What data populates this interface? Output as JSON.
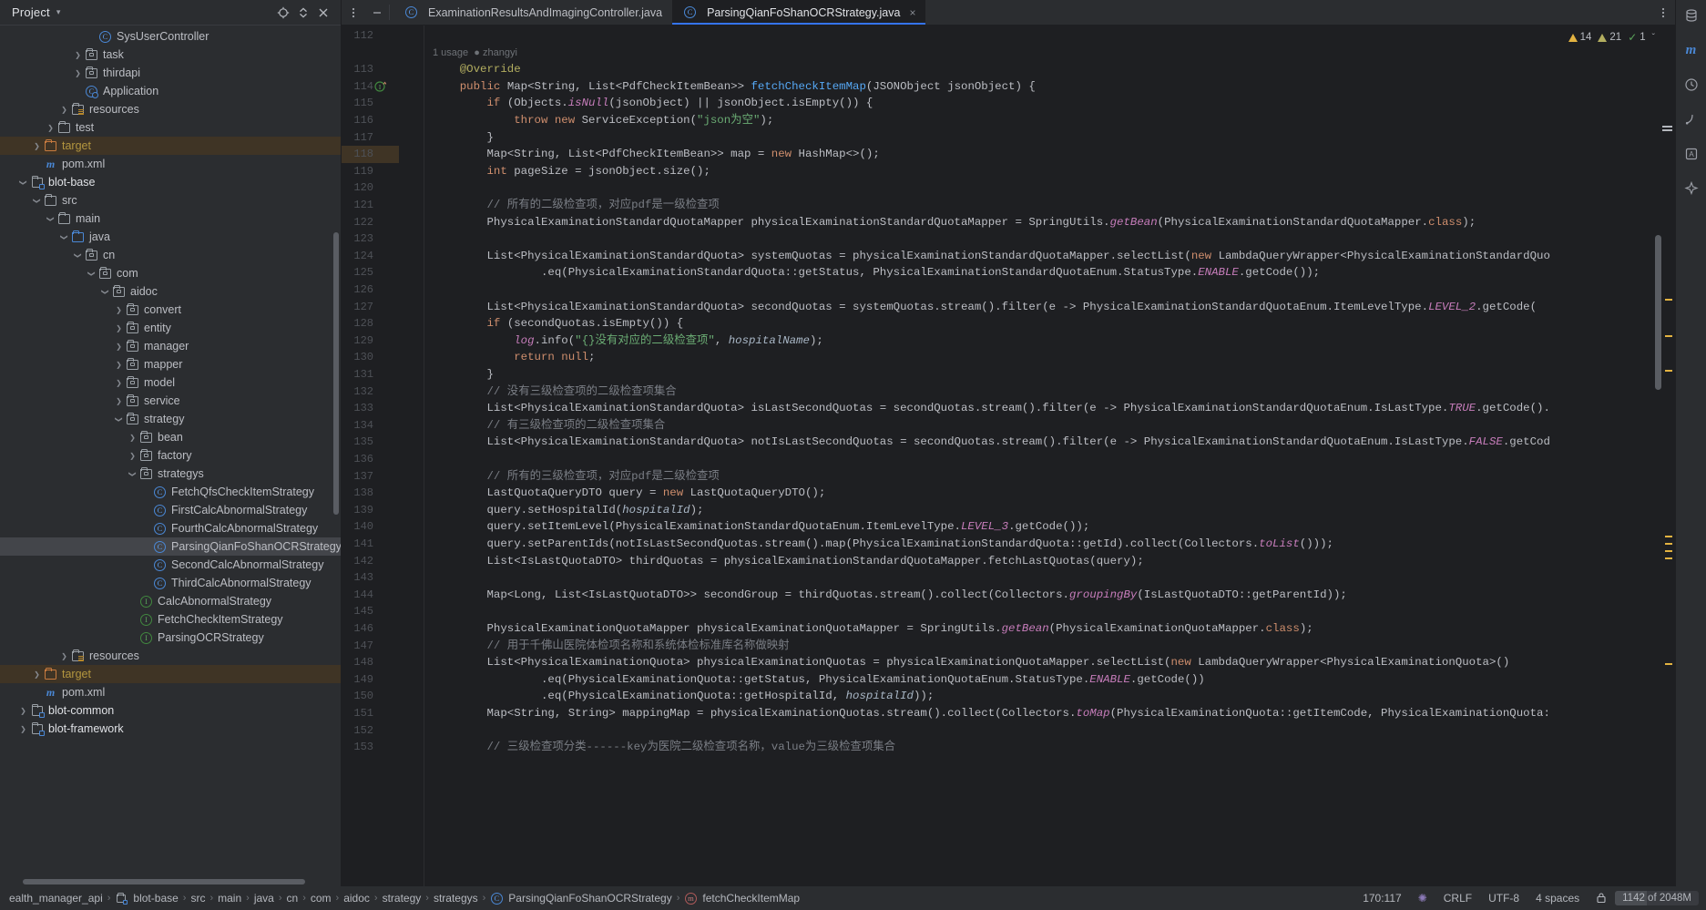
{
  "window": {
    "project_panel_title": "Project",
    "header_icons": [
      "target-icon",
      "collapse-icon",
      "close-icon",
      "more-icon",
      "minimize-icon"
    ]
  },
  "tabs": {
    "items": [
      {
        "label": "ExaminationResultsAndImagingController.java",
        "icon": "java-class-icon",
        "active": false,
        "closable": false
      },
      {
        "label": "ParsingQianFoShanOCRStrategy.java",
        "icon": "java-class-icon",
        "active": true,
        "closable": true,
        "close_glyph": "×"
      }
    ]
  },
  "inspections": {
    "warnings_count": "14",
    "weak_warnings_count": "21",
    "checks_count": "1",
    "chevron": "ˇ"
  },
  "tree": {
    "items": [
      {
        "indent": 6,
        "arrow": "none",
        "icon": "java-class-icon",
        "label": "SysUserController",
        "state": ""
      },
      {
        "indent": 5,
        "arrow": "right",
        "icon": "package-icon",
        "label": "task",
        "state": ""
      },
      {
        "indent": 5,
        "arrow": "right",
        "icon": "package-icon",
        "label": "thirdapi",
        "state": ""
      },
      {
        "indent": 5,
        "arrow": "none",
        "icon": "spring-application-icon",
        "label": "Application",
        "state": ""
      },
      {
        "indent": 4,
        "arrow": "right",
        "icon": "resources-folder-icon",
        "label": "resources",
        "state": ""
      },
      {
        "indent": 3,
        "arrow": "right",
        "icon": "folder-icon",
        "label": "test",
        "state": ""
      },
      {
        "indent": 2,
        "arrow": "right",
        "icon": "folder-orange-icon",
        "label": "target",
        "state": "target"
      },
      {
        "indent": 2,
        "arrow": "none",
        "icon": "maven-icon",
        "label": "pom.xml",
        "state": ""
      },
      {
        "indent": 1,
        "arrow": "down",
        "icon": "module-icon",
        "label": "blot-base",
        "state": "bold"
      },
      {
        "indent": 2,
        "arrow": "down",
        "icon": "folder-icon",
        "label": "src",
        "state": ""
      },
      {
        "indent": 3,
        "arrow": "down",
        "icon": "folder-icon",
        "label": "main",
        "state": ""
      },
      {
        "indent": 4,
        "arrow": "down",
        "icon": "source-folder-icon",
        "label": "java",
        "state": ""
      },
      {
        "indent": 5,
        "arrow": "down",
        "icon": "package-icon",
        "label": "cn",
        "state": ""
      },
      {
        "indent": 6,
        "arrow": "down",
        "icon": "package-icon",
        "label": "com",
        "state": ""
      },
      {
        "indent": 7,
        "arrow": "down",
        "icon": "package-icon",
        "label": "aidoc",
        "state": ""
      },
      {
        "indent": 8,
        "arrow": "right",
        "icon": "package-icon",
        "label": "convert",
        "state": ""
      },
      {
        "indent": 8,
        "arrow": "right",
        "icon": "package-icon",
        "label": "entity",
        "state": ""
      },
      {
        "indent": 8,
        "arrow": "right",
        "icon": "package-icon",
        "label": "manager",
        "state": ""
      },
      {
        "indent": 8,
        "arrow": "right",
        "icon": "package-icon",
        "label": "mapper",
        "state": ""
      },
      {
        "indent": 8,
        "arrow": "right",
        "icon": "package-icon",
        "label": "model",
        "state": ""
      },
      {
        "indent": 8,
        "arrow": "right",
        "icon": "package-icon",
        "label": "service",
        "state": ""
      },
      {
        "indent": 8,
        "arrow": "down",
        "icon": "package-icon",
        "label": "strategy",
        "state": ""
      },
      {
        "indent": 9,
        "arrow": "right",
        "icon": "package-icon",
        "label": "bean",
        "state": ""
      },
      {
        "indent": 9,
        "arrow": "right",
        "icon": "package-icon",
        "label": "factory",
        "state": ""
      },
      {
        "indent": 9,
        "arrow": "down",
        "icon": "package-icon",
        "label": "strategys",
        "state": ""
      },
      {
        "indent": 10,
        "arrow": "none",
        "icon": "java-class-icon",
        "label": "FetchQfsCheckItemStrategy",
        "state": ""
      },
      {
        "indent": 10,
        "arrow": "none",
        "icon": "java-class-icon",
        "label": "FirstCalcAbnormalStrategy",
        "state": ""
      },
      {
        "indent": 10,
        "arrow": "none",
        "icon": "java-class-icon",
        "label": "FourthCalcAbnormalStrategy",
        "state": ""
      },
      {
        "indent": 10,
        "arrow": "none",
        "icon": "java-class-icon",
        "label": "ParsingQianFoShanOCRStrategy",
        "state": "selected"
      },
      {
        "indent": 10,
        "arrow": "none",
        "icon": "java-class-icon",
        "label": "SecondCalcAbnormalStrategy",
        "state": ""
      },
      {
        "indent": 10,
        "arrow": "none",
        "icon": "java-class-icon",
        "label": "ThirdCalcAbnormalStrategy",
        "state": ""
      },
      {
        "indent": 9,
        "arrow": "none",
        "icon": "java-interface-icon",
        "label": "CalcAbnormalStrategy",
        "state": ""
      },
      {
        "indent": 9,
        "arrow": "none",
        "icon": "java-interface-icon",
        "label": "FetchCheckItemStrategy",
        "state": ""
      },
      {
        "indent": 9,
        "arrow": "none",
        "icon": "java-interface-icon",
        "label": "ParsingOCRStrategy",
        "state": ""
      },
      {
        "indent": 4,
        "arrow": "right",
        "icon": "resources-folder-icon",
        "label": "resources",
        "state": ""
      },
      {
        "indent": 2,
        "arrow": "right",
        "icon": "folder-orange-icon",
        "label": "target",
        "state": "target"
      },
      {
        "indent": 2,
        "arrow": "none",
        "icon": "maven-icon",
        "label": "pom.xml",
        "state": ""
      },
      {
        "indent": 1,
        "arrow": "right",
        "icon": "module-icon",
        "label": "blot-common",
        "state": "bold"
      },
      {
        "indent": 1,
        "arrow": "right",
        "icon": "module-icon",
        "label": "blot-framework",
        "state": "bold"
      }
    ]
  },
  "editor": {
    "inlay_hint": {
      "usages": "1 usage",
      "author": "zhangyi"
    },
    "first_line_number": 112,
    "lines": [
      {
        "n": 112,
        "tokens": []
      },
      {
        "n": 113,
        "tokens": [
          {
            "t": "@Override",
            "c": "anno",
            "i": 4
          }
        ]
      },
      {
        "n": 114,
        "gutter_icon": "override-method-icon",
        "tokens": [
          {
            "t": "public ",
            "c": "kw",
            "i": 4
          },
          {
            "t": "Map<String, List<PdfCheckItemBean>> ",
            "c": "ty"
          },
          {
            "t": "fetchCheckItemMap",
            "c": "meth"
          },
          {
            "t": "(JSONObject jsonObject) {",
            "c": "ty"
          }
        ]
      },
      {
        "n": 115,
        "tokens": [
          {
            "t": "if ",
            "c": "kw",
            "i": 8
          },
          {
            "t": "(Objects.",
            "c": "ty"
          },
          {
            "t": "isNull",
            "c": "st"
          },
          {
            "t": "(jsonObject) || jsonObject.isEmpty()) {",
            "c": "ty"
          }
        ]
      },
      {
        "n": 116,
        "tokens": [
          {
            "t": "throw new ",
            "c": "kw",
            "i": 12
          },
          {
            "t": "ServiceException(",
            "c": "ty"
          },
          {
            "t": "\"json为空\"",
            "c": "str"
          },
          {
            "t": ");",
            "c": "ty"
          }
        ]
      },
      {
        "n": 117,
        "tokens": [
          {
            "t": "}",
            "c": "ty",
            "i": 8
          }
        ]
      },
      {
        "n": 118,
        "tokens": [
          {
            "t": "Map<String, List<PdfCheckItemBean>> map = ",
            "c": "ty",
            "i": 8
          },
          {
            "t": "new ",
            "c": "kw"
          },
          {
            "t": "HashMap<>();",
            "c": "ty"
          }
        ]
      },
      {
        "n": 119,
        "tokens": [
          {
            "t": "int ",
            "c": "kw",
            "i": 8
          },
          {
            "t": "pageSize = jsonObject.size();",
            "c": "ty"
          }
        ]
      },
      {
        "n": 120,
        "tokens": []
      },
      {
        "n": 121,
        "tokens": [
          {
            "t": "// 所有的二级检查项，对应pdf是一级检查项",
            "c": "cmt",
            "i": 8
          }
        ]
      },
      {
        "n": 122,
        "tokens": [
          {
            "t": "PhysicalExaminationStandardQuotaMapper physicalExaminationStandardQuotaMapper = SpringUtils.",
            "c": "ty",
            "i": 8
          },
          {
            "t": "getBean",
            "c": "st"
          },
          {
            "t": "(PhysicalExaminationStandardQuotaMapper.",
            "c": "ty"
          },
          {
            "t": "class",
            "c": "kw"
          },
          {
            "t": ");",
            "c": "ty"
          }
        ]
      },
      {
        "n": 123,
        "tokens": []
      },
      {
        "n": 124,
        "tokens": [
          {
            "t": "List<PhysicalExaminationStandardQuota> systemQuotas = physicalExaminationStandardQuotaMapper.selectList(",
            "c": "ty",
            "i": 8
          },
          {
            "t": "new ",
            "c": "kw"
          },
          {
            "t": "LambdaQueryWrapper<PhysicalExaminationStandardQuo",
            "c": "ty"
          }
        ]
      },
      {
        "n": 125,
        "tokens": [
          {
            "t": ".eq(PhysicalExaminationStandardQuota::getStatus, PhysicalExaminationStandardQuotaEnum.StatusType.",
            "c": "ty",
            "i": 16
          },
          {
            "t": "ENABLE",
            "c": "st"
          },
          {
            "t": ".getCode());",
            "c": "ty"
          }
        ]
      },
      {
        "n": 126,
        "tokens": []
      },
      {
        "n": 127,
        "tokens": [
          {
            "t": "List<PhysicalExaminationStandardQuota> secondQuotas = systemQuotas.stream().filter(e -> PhysicalExaminationStandardQuotaEnum.ItemLevelType.",
            "c": "ty",
            "i": 8
          },
          {
            "t": "LEVEL_2",
            "c": "st"
          },
          {
            "t": ".getCode(",
            "c": "ty"
          }
        ]
      },
      {
        "n": 128,
        "tokens": [
          {
            "t": "if ",
            "c": "kw",
            "i": 8
          },
          {
            "t": "(secondQuotas.isEmpty()) {",
            "c": "ty"
          }
        ]
      },
      {
        "n": 129,
        "tokens": [
          {
            "t": "log",
            "c": "st",
            "i": 12
          },
          {
            "t": ".info(",
            "c": "ty"
          },
          {
            "t": "\"{}没有对应的二级检查项\"",
            "c": "str"
          },
          {
            "t": ", ",
            "c": "ty"
          },
          {
            "t": "hospitalName",
            "c": "par"
          },
          {
            "t": ");",
            "c": "ty"
          }
        ]
      },
      {
        "n": 130,
        "tokens": [
          {
            "t": "return null",
            "c": "kw",
            "i": 12
          },
          {
            "t": ";",
            "c": "ty"
          }
        ]
      },
      {
        "n": 131,
        "tokens": [
          {
            "t": "}",
            "c": "ty",
            "i": 8
          }
        ]
      },
      {
        "n": 132,
        "tokens": [
          {
            "t": "// 没有三级检查项的二级检查项集合",
            "c": "cmt",
            "i": 8
          }
        ]
      },
      {
        "n": 133,
        "tokens": [
          {
            "t": "List<PhysicalExaminationStandardQuota> isLastSecondQuotas = secondQuotas.stream().filter(e -> PhysicalExaminationStandardQuotaEnum.IsLastType.",
            "c": "ty",
            "i": 8
          },
          {
            "t": "TRUE",
            "c": "st"
          },
          {
            "t": ".getCode().",
            "c": "ty"
          }
        ]
      },
      {
        "n": 134,
        "tokens": [
          {
            "t": "// 有三级检查项的二级检查项集合",
            "c": "cmt",
            "i": 8
          }
        ]
      },
      {
        "n": 135,
        "tokens": [
          {
            "t": "List<PhysicalExaminationStandardQuota> notIsLastSecondQuotas = secondQuotas.stream().filter(e -> PhysicalExaminationStandardQuotaEnum.IsLastType.",
            "c": "ty",
            "i": 8
          },
          {
            "t": "FALSE",
            "c": "st"
          },
          {
            "t": ".getCod",
            "c": "ty"
          }
        ]
      },
      {
        "n": 136,
        "tokens": []
      },
      {
        "n": 137,
        "tokens": [
          {
            "t": "// 所有的三级检查项，对应pdf是二级检查项",
            "c": "cmt",
            "i": 8
          }
        ]
      },
      {
        "n": 138,
        "tokens": [
          {
            "t": "LastQuotaQueryDTO query = ",
            "c": "ty",
            "i": 8
          },
          {
            "t": "new ",
            "c": "kw"
          },
          {
            "t": "LastQuotaQueryDTO();",
            "c": "ty"
          }
        ]
      },
      {
        "n": 139,
        "tokens": [
          {
            "t": "query.setHospitalId(",
            "c": "ty",
            "i": 8
          },
          {
            "t": "hospitalId",
            "c": "par"
          },
          {
            "t": ");",
            "c": "ty"
          }
        ]
      },
      {
        "n": 140,
        "tokens": [
          {
            "t": "query.setItemLevel(PhysicalExaminationStandardQuotaEnum.ItemLevelType.",
            "c": "ty",
            "i": 8
          },
          {
            "t": "LEVEL_3",
            "c": "st"
          },
          {
            "t": ".getCode());",
            "c": "ty"
          }
        ]
      },
      {
        "n": 141,
        "tokens": [
          {
            "t": "query.setParentIds(notIsLastSecondQuotas.stream().map(PhysicalExaminationStandardQuota::getId).collect(Collectors.",
            "c": "ty",
            "i": 8
          },
          {
            "t": "toList",
            "c": "st"
          },
          {
            "t": "()));",
            "c": "ty"
          }
        ]
      },
      {
        "n": 142,
        "tokens": [
          {
            "t": "List<IsLastQuotaDTO> thirdQuotas = physicalExaminationStandardQuotaMapper.fetchLastQuotas(query);",
            "c": "ty",
            "i": 8
          }
        ]
      },
      {
        "n": 143,
        "tokens": []
      },
      {
        "n": 144,
        "tokens": [
          {
            "t": "Map<Long, List<IsLastQuotaDTO>> secondGroup = thirdQuotas.stream().collect(Collectors.",
            "c": "ty",
            "i": 8
          },
          {
            "t": "groupingBy",
            "c": "st"
          },
          {
            "t": "(IsLastQuotaDTO::getParentId));",
            "c": "ty"
          }
        ]
      },
      {
        "n": 145,
        "tokens": []
      },
      {
        "n": 146,
        "tokens": [
          {
            "t": "PhysicalExaminationQuotaMapper physicalExaminationQuotaMapper = SpringUtils.",
            "c": "ty",
            "i": 8
          },
          {
            "t": "getBean",
            "c": "st"
          },
          {
            "t": "(PhysicalExaminationQuotaMapper.",
            "c": "ty"
          },
          {
            "t": "class",
            "c": "kw"
          },
          {
            "t": ");",
            "c": "ty"
          }
        ]
      },
      {
        "n": 147,
        "tokens": [
          {
            "t": "// 用于千佛山医院体检项名称和系统体检标准库名称做映射",
            "c": "cmt",
            "i": 8
          }
        ]
      },
      {
        "n": 148,
        "tokens": [
          {
            "t": "List<PhysicalExaminationQuota> physicalExaminationQuotas = physicalExaminationQuotaMapper.selectList(",
            "c": "ty",
            "i": 8
          },
          {
            "t": "new ",
            "c": "kw"
          },
          {
            "t": "LambdaQueryWrapper<PhysicalExaminationQuota>()",
            "c": "ty"
          }
        ]
      },
      {
        "n": 149,
        "tokens": [
          {
            "t": ".eq(PhysicalExaminationQuota::getStatus, PhysicalExaminationQuotaEnum.StatusType.",
            "c": "ty",
            "i": 16
          },
          {
            "t": "ENABLE",
            "c": "st"
          },
          {
            "t": ".getCode())",
            "c": "ty"
          }
        ]
      },
      {
        "n": 150,
        "tokens": [
          {
            "t": ".eq(PhysicalExaminationQuota::getHospitalId, ",
            "c": "ty",
            "i": 16
          },
          {
            "t": "hospitalId",
            "c": "par"
          },
          {
            "t": "));",
            "c": "ty"
          }
        ]
      },
      {
        "n": 151,
        "tokens": [
          {
            "t": "Map<String, String> mappingMap = physicalExaminationQuotas.stream().collect(Collectors.",
            "c": "ty",
            "i": 8
          },
          {
            "t": "toMap",
            "c": "st"
          },
          {
            "t": "(PhysicalExaminationQuota::getItemCode, PhysicalExaminationQuota:",
            "c": "ty"
          }
        ]
      },
      {
        "n": 152,
        "tokens": []
      },
      {
        "n": 153,
        "tokens": [
          {
            "t": "// 三级检查项分类------key为医院二级检查项名称，value为三级检查项集合",
            "c": "cmt",
            "i": 8
          }
        ]
      }
    ]
  },
  "statusbar": {
    "breadcrumbs": [
      {
        "label": "ealth_manager_api",
        "icon": ""
      },
      {
        "label": "blot-base",
        "icon": "module-icon"
      },
      {
        "label": "src",
        "icon": ""
      },
      {
        "label": "main",
        "icon": ""
      },
      {
        "label": "java",
        "icon": ""
      },
      {
        "label": "cn",
        "icon": ""
      },
      {
        "label": "com",
        "icon": ""
      },
      {
        "label": "aidoc",
        "icon": ""
      },
      {
        "label": "strategy",
        "icon": ""
      },
      {
        "label": "strategys",
        "icon": ""
      },
      {
        "label": "ParsingQianFoShanOCRStrategy",
        "icon": "java-class-icon"
      },
      {
        "label": "fetchCheckItemMap",
        "icon": "method-icon"
      }
    ],
    "separator": "›",
    "caret_position": "170:117",
    "line_separator": "CRLF",
    "encoding": "UTF-8",
    "indent": "4 spaces",
    "memory": "1142 of 2048M"
  },
  "right_toolbar": {
    "icons": [
      "database-icon",
      "maven-icon",
      "ai-assistant-icon",
      "notifications-icon",
      "bookmarks-icon",
      "structure-icon",
      "sparkle-icon"
    ]
  }
}
